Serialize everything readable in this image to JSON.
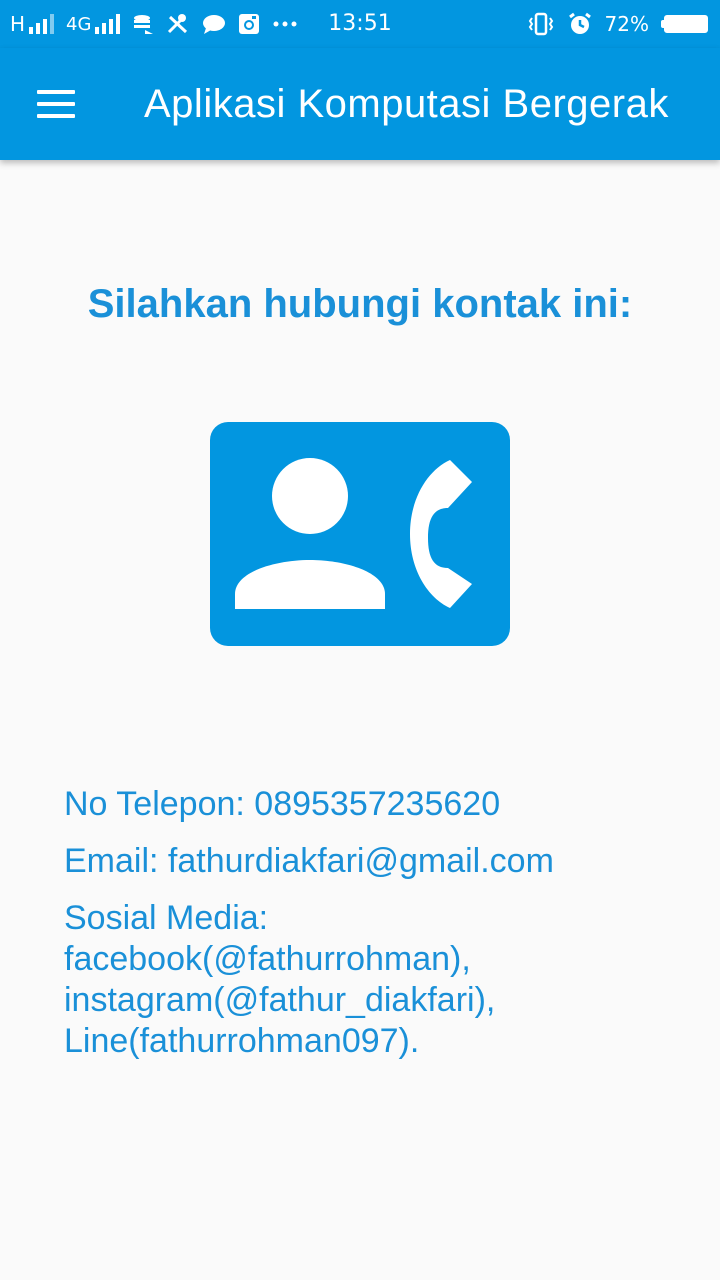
{
  "status_bar": {
    "network_left": "H",
    "network_4g": "4G",
    "time": "13:51",
    "battery_percent": "72%",
    "icons": [
      "signal-icon",
      "database-icon",
      "tools-icon",
      "chat-icon",
      "instagram-icon",
      "more-dots-icon",
      "vibrate-icon",
      "alarm-icon",
      "battery-icon"
    ]
  },
  "app_bar": {
    "title": "Aplikasi Komputasi Bergerak",
    "menu_icon": "hamburger-menu-icon",
    "color": "#0296e0"
  },
  "main": {
    "heading": "Silahkan hubungi kontak ini:",
    "contact_icon": "contact-phone-icon",
    "phone": "No Telepon: 0895357235620",
    "email": "Email: fathurdiakfari@gmail.com",
    "social_label": "Sosial Media:",
    "social_lines": [
      "facebook(@fathurrohman),",
      "instagram(@fathur_diakfari),",
      "Line(fathurrohman097)."
    ],
    "text_color": "#1a90d8"
  }
}
